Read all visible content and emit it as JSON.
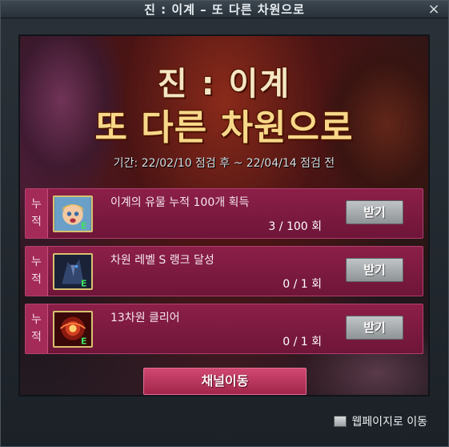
{
  "window": {
    "title": "진 : 이계 – 또 다른 차원으로",
    "close": "×"
  },
  "banner": {
    "headline1": "진 : 이계",
    "headline2": "또 다른 차원으로",
    "period": "기간: 22/02/10 점검 후 ~ 22/04/14 점검 전"
  },
  "missions": [
    {
      "tag1": "누",
      "tag2": "적",
      "title": "이계의 유물 누적 100개 획득",
      "progress": "3 / 100 회",
      "button": "받기",
      "icon": "character-portrait-icon",
      "current": 3,
      "goal": 100
    },
    {
      "tag1": "누",
      "tag2": "적",
      "title": "차원 레벨 S 랭크 달성",
      "progress": "0 / 1 회",
      "button": "받기",
      "icon": "dark-warrior-icon",
      "current": 0,
      "goal": 1
    },
    {
      "tag1": "누",
      "tag2": "적",
      "title": "13차원 클리어",
      "progress": "0 / 1 회",
      "button": "받기",
      "icon": "dimension-vortex-icon",
      "current": 0,
      "goal": 1
    }
  ],
  "channel_button": "채널이동",
  "web_link": "웹페이지로 이동",
  "colors": {
    "mission_bg": "#8c1f48",
    "accent": "#d04872",
    "title_gold": "#f7d88a"
  }
}
